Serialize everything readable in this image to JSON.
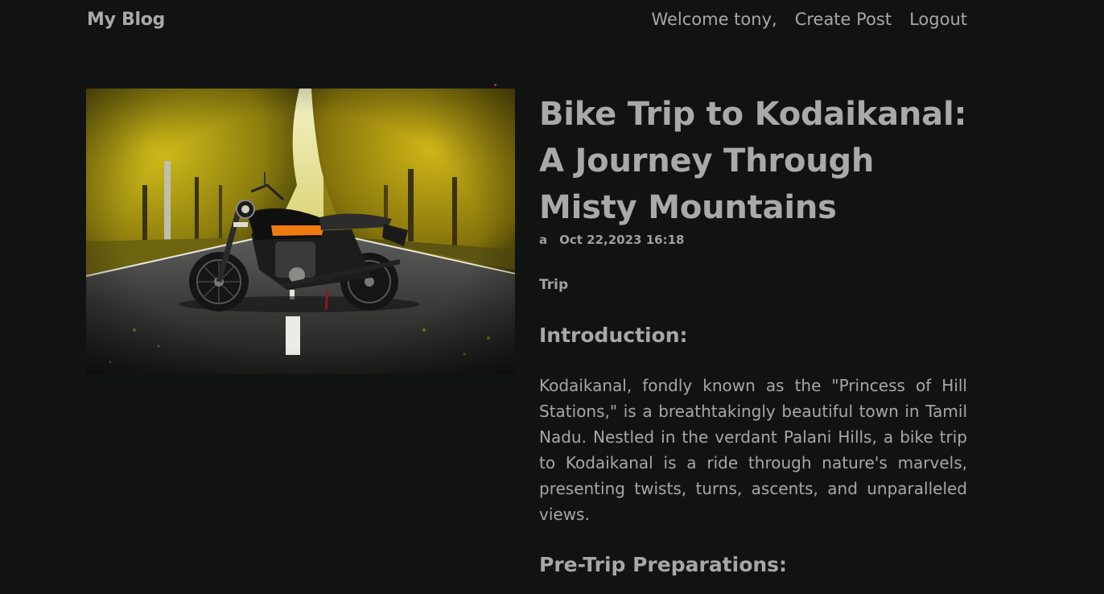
{
  "header": {
    "logo": "My Blog",
    "welcome": "Welcome tony,",
    "create_post": "Create Post",
    "logout": "Logout"
  },
  "post": {
    "title": "Bike Trip to Kodaikanal: A Journey Through Misty Mountains",
    "author": "a",
    "date": "Oct 22,2023 16:18",
    "category": "Trip",
    "sections": [
      {
        "heading": "Introduction:",
        "text": "Kodaikanal, fondly known as the \"Princess of Hill Stations,\" is a breathtakingly beautiful town in Tamil Nadu. Nestled in the verdant Palani Hills, a bike trip to Kodaikanal is a ride through nature's marvels, presenting twists, turns, ascents, and unparalleled views."
      },
      {
        "heading": "Pre-Trip Preparations:"
      }
    ]
  },
  "colors": {
    "background": "#111313",
    "text": "#a7a7a7",
    "image_accent_orange": "#f07a10",
    "image_foliage_yellow": "#c8b018"
  },
  "image": {
    "icon": "motorcycle-photo"
  }
}
